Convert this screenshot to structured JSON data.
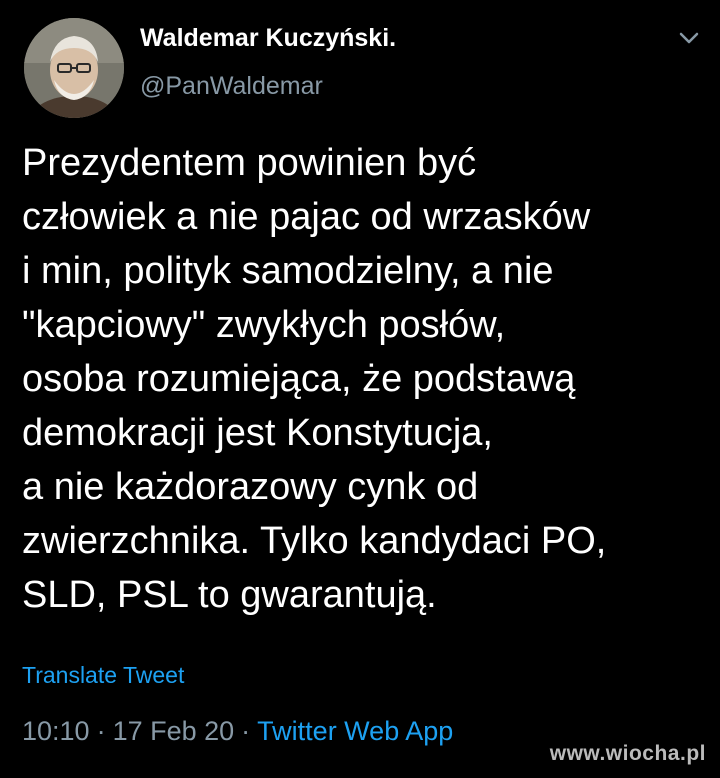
{
  "tweet": {
    "author": {
      "display_name": "Waldemar Kuczyński.",
      "handle": "@PanWaldemar",
      "avatar_icon": "profile-photo"
    },
    "menu_icon": "chevron-down-icon",
    "body_lines": [
      "Prezydentem powinien być",
      "człowiek a nie pajac od wrzasków",
      "i min, polityk samodzielny, a nie",
      "\"kapciowy\" zwykłych posłów,",
      "osoba rozumiejąca, że podstawą",
      "demokracji jest Konstytucja,",
      "a nie każdorazowy cynk od",
      "zwierzchnika. Tylko kandydaci PO,",
      "SLD, PSL to gwarantują."
    ],
    "translate_label": "Translate Tweet",
    "time": "10:10",
    "separator": "·",
    "date": "17 Feb 20",
    "source": "Twitter Web App"
  },
  "watermark": "www.wiocha.pl",
  "colors": {
    "background": "#000000",
    "text": "#ffffff",
    "secondary": "#8899a6",
    "link": "#1da1f2"
  }
}
